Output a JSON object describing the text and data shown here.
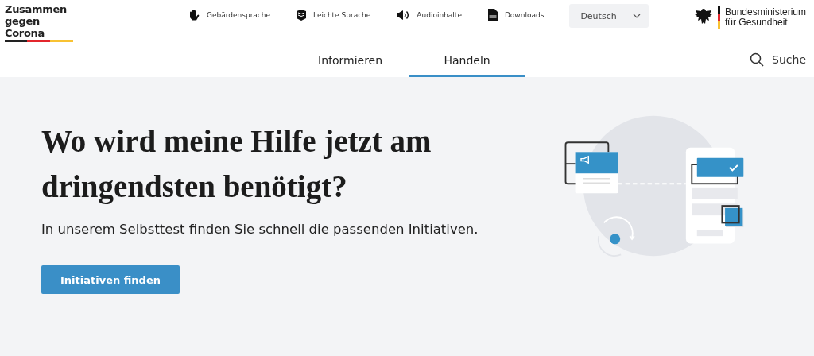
{
  "logo": {
    "lines": [
      "Zusammen",
      "gegen Corona"
    ]
  },
  "utility_links": [
    {
      "kind": "hand",
      "label": "Gebärdensprache"
    },
    {
      "kind": "book",
      "label": "Leichte Sprache"
    },
    {
      "kind": "audio",
      "label": "Audioinhalte"
    },
    {
      "kind": "file",
      "label": "Downloads"
    }
  ],
  "language_select": {
    "value": "Deutsch"
  },
  "ministry": {
    "lines": [
      "Bundesministerium",
      "für Gesundheit"
    ]
  },
  "nav_tabs": [
    {
      "label": "Informieren",
      "selected": false
    },
    {
      "label": "Handeln",
      "selected": true
    }
  ],
  "search": {
    "label": "Suche"
  },
  "hero": {
    "heading": "Wo wird meine Hilfe jetzt am dringendsten benötigt?",
    "subtitle": "In unserem Selbsttest finden Sie schnell die passenden Initiativen.",
    "button": "Initiativen finden"
  }
}
